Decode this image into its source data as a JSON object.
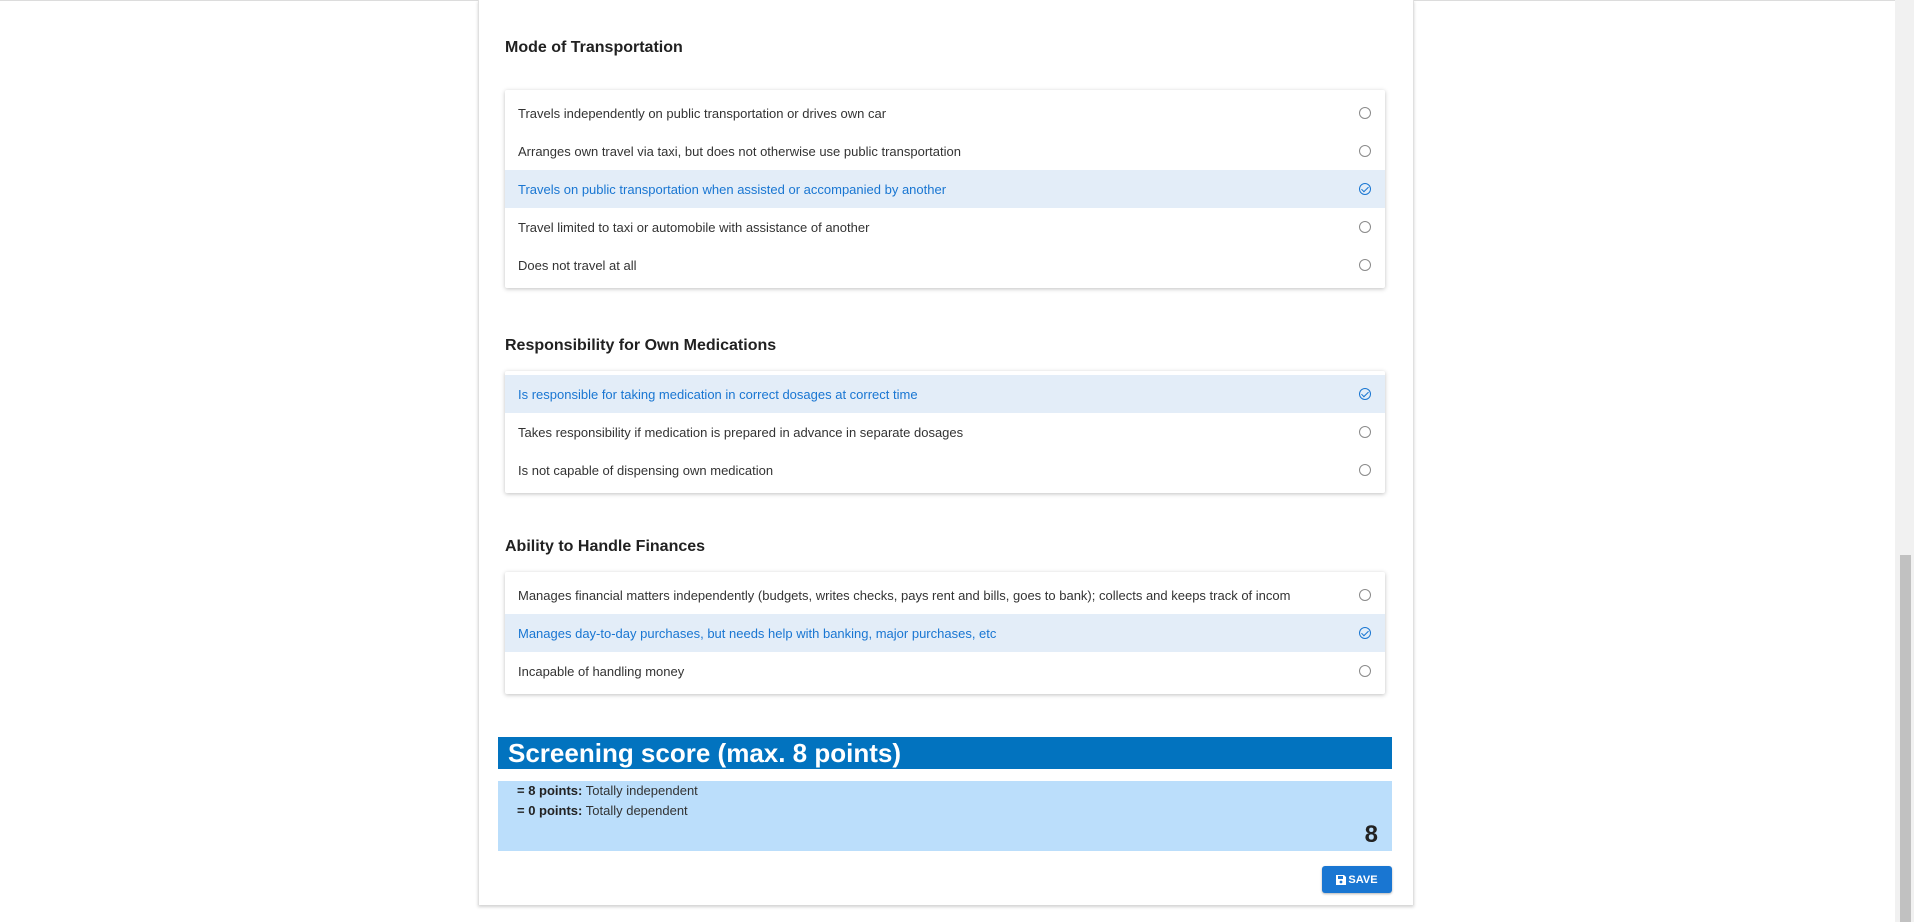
{
  "sections": [
    {
      "title": "Mode of Transportation",
      "options": [
        {
          "label": "Travels independently on public transportation or drives own car",
          "selected": false
        },
        {
          "label": "Arranges own travel via taxi, but does not otherwise use public transportation",
          "selected": false
        },
        {
          "label": "Travels on public transportation when assisted or accompanied by another",
          "selected": true
        },
        {
          "label": "Travel limited to taxi or automobile with assistance of another",
          "selected": false
        },
        {
          "label": "Does not travel at all",
          "selected": false
        }
      ]
    },
    {
      "title": "Responsibility for Own Medications",
      "options": [
        {
          "label": "Is responsible for taking medication in correct dosages at correct time",
          "selected": true
        },
        {
          "label": "Takes responsibility if medication is prepared in advance in separate dosages",
          "selected": false
        },
        {
          "label": "Is not capable of dispensing own medication",
          "selected": false
        }
      ]
    },
    {
      "title": "Ability to Handle Finances",
      "options": [
        {
          "label": "Manages financial matters independently (budgets, writes checks, pays rent and bills, goes to bank); collects and keeps track of incom",
          "selected": false
        },
        {
          "label": "Manages day-to-day purchases, but needs help with banking, major purchases, etc",
          "selected": true
        },
        {
          "label": "Incapable of handling money",
          "selected": false
        }
      ]
    }
  ],
  "score": {
    "header": "Screening score (max. 8 points)",
    "legend": [
      {
        "bold": "= 8 points:",
        "text": " Totally independent"
      },
      {
        "bold": "= 0 points:",
        "text": " Totally dependent"
      }
    ],
    "value": "8"
  },
  "save_label": "SAVE",
  "colors": {
    "accent": "#1976d2",
    "header": "#0273bf",
    "score_bg": "#bbdefb",
    "selected_bg": "#e3edf8"
  }
}
